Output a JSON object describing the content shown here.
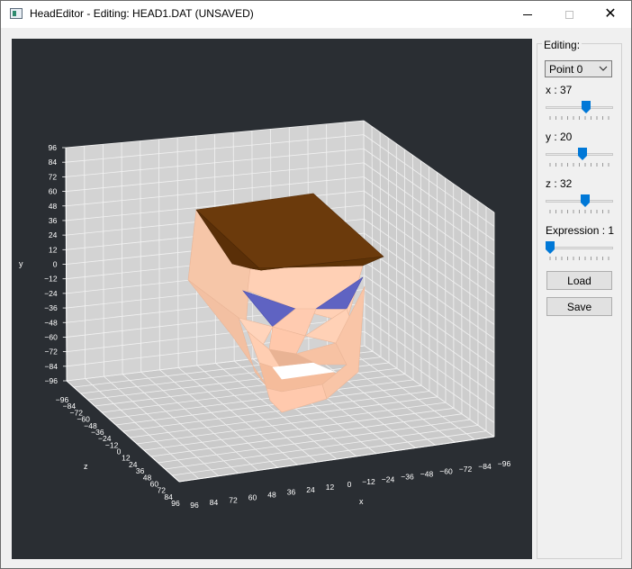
{
  "window": {
    "title": "HeadEditor - Editing: HEAD1.DAT (UNSAVED)",
    "controls": [
      "minimize",
      "maximize",
      "close"
    ]
  },
  "panel": {
    "group_label": "Editing:",
    "point_select": {
      "value": "Point 0"
    },
    "sliders": [
      {
        "label": "x : 37",
        "level": 0.62
      },
      {
        "label": "y : 20",
        "level": 0.55
      },
      {
        "label": "z : 32",
        "level": 0.6
      },
      {
        "label": "Expression : 1",
        "level": 0.0
      }
    ],
    "load_label": "Load",
    "save_label": "Save"
  },
  "plot": {
    "background": "#2a2e33",
    "pane_color": "#d3d3d3",
    "axis_labels": {
      "y": "y",
      "z": "z",
      "x": "x"
    },
    "y_ticks": [
      "96",
      "84",
      "72",
      "60",
      "48",
      "36",
      "24",
      "12",
      "0",
      "−12",
      "−24",
      "−36",
      "−48",
      "−60",
      "−72",
      "−84",
      "−96"
    ],
    "z_ticks": [
      "−96",
      "−84",
      "−72",
      "−60",
      "−48",
      "−36",
      "−24",
      "−12",
      "0",
      "12",
      "24",
      "36",
      "48",
      "60",
      "72",
      "84",
      "96"
    ],
    "x_ticks": [
      "96",
      "84",
      "72",
      "60",
      "48",
      "36",
      "24",
      "12",
      "0",
      "−12",
      "−24",
      "−36",
      "−48",
      "−60",
      "−72",
      "−84",
      "−96"
    ],
    "face_colors": {
      "skin": "#ffcdb2",
      "hair": "#6b3a0c",
      "eyes": "#5f63c2",
      "mouth": "#ffffff"
    }
  }
}
